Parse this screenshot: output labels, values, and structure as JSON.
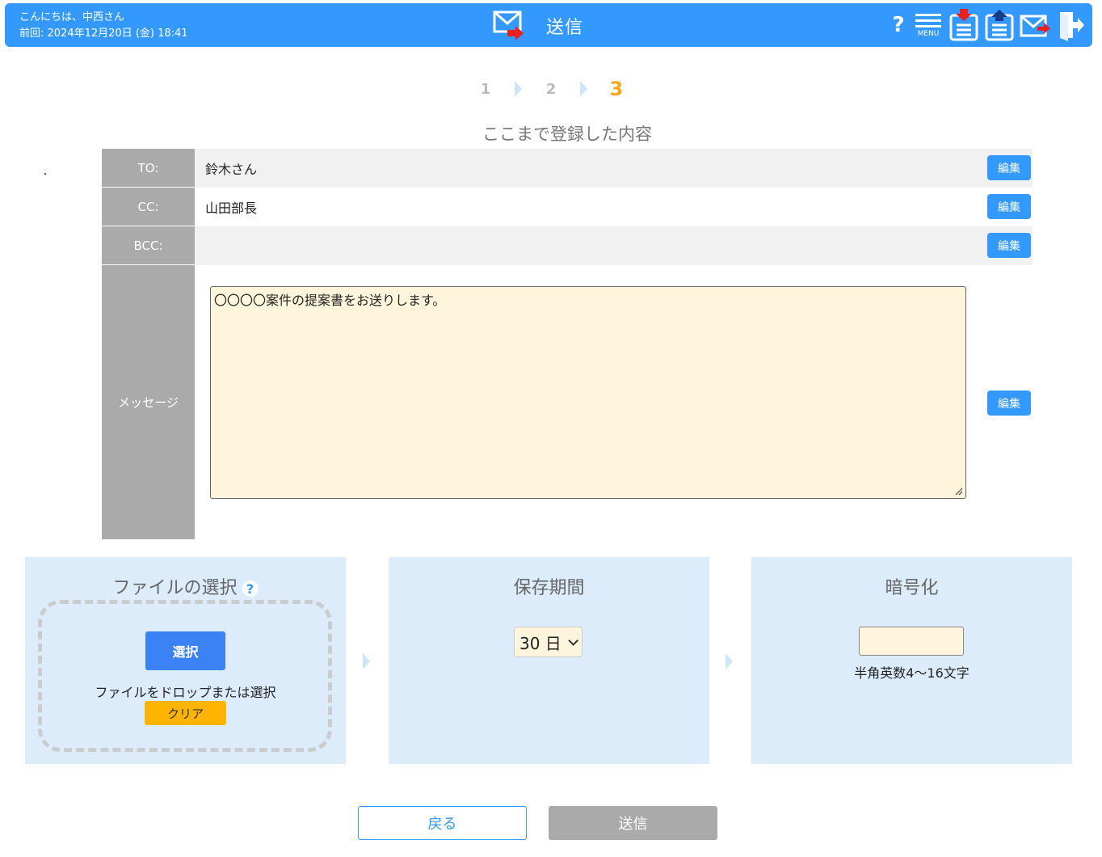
{
  "header": {
    "greeting": "こんにちは、中西さん",
    "last_login": "前回: 2024年12月20日 (金) 18:41",
    "title": "送信",
    "menu_label": "MENU",
    "help_label": "?"
  },
  "steps": [
    "1",
    "2",
    "3"
  ],
  "summary": {
    "title": "ここまで登録した内容",
    "edit_label": "編集",
    "to_label": "TO:",
    "to_value": "鈴木さん",
    "cc_label": "CC:",
    "cc_value": "山田部長",
    "bcc_label": "BCC:",
    "bcc_value": "",
    "message_label": "メッセージ",
    "message_value": "〇〇〇〇案件の提案書をお送りします。"
  },
  "file_panel": {
    "title": "ファイルの選択",
    "help_label": "?",
    "select_label": "選択",
    "drop_text": "ファイルをドロップまたは選択",
    "clear_label": "クリア"
  },
  "period_panel": {
    "title": "保存期間",
    "selected": "30 日"
  },
  "encrypt_panel": {
    "title": "暗号化",
    "password_value": "",
    "hint": "半角英数4～16文字"
  },
  "actions": {
    "back_label": "戻る",
    "send_label": "送信"
  },
  "colors": {
    "header_bg": "#3399ff",
    "panel_bg": "#dcecfb",
    "input_bg": "#fff5dc",
    "active_step": "#f5a623",
    "clear_btn": "#ffb400"
  }
}
